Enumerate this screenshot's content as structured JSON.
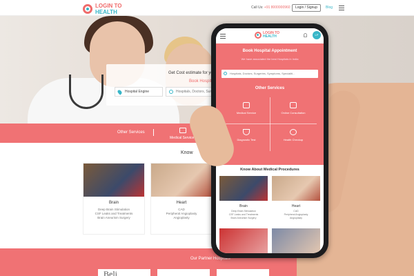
{
  "header": {
    "logo_line1": "LOGIN TO",
    "logo_line2": "HEALTH",
    "call_label": "Call Us:",
    "call_number": "+91 8000000960",
    "login_label": "Login / Signup",
    "blog_label": "Blog"
  },
  "hero": {
    "cost_title": "Get Cost estimate for yo",
    "cost_link": "Book Hospital",
    "location_value": "Hospital Engine",
    "search_placeholder": "Hospitals, Doctors, Surgeries"
  },
  "services_bar": {
    "label": "Other Services",
    "item": "Medical Service"
  },
  "know": {
    "title": "Know",
    "cards": [
      {
        "title": "Brain",
        "lines": [
          "Deep Brain Stimulation",
          "CSF Leaks and Treatments",
          "Brain Aneurism Surgery"
        ]
      },
      {
        "title": "Heart",
        "lines": [
          "CAD",
          "Peripheral Angioplasty",
          "Angioplasty"
        ]
      }
    ]
  },
  "partners": {
    "label": "Our Partner Hospitals",
    "first_logo_text": "Beli"
  },
  "phone": {
    "logo_line1": "LOGIN TO",
    "logo_line2": "HEALTH",
    "user_initials": "LP",
    "book_title": "Book Hospital Appointment",
    "book_sub": "We have associated the best Hospitals in India",
    "search_placeholder": "Hospitals, Doctors, Surgeries, Symptoms, Specialiti...",
    "other_services": "Other Services",
    "services": [
      "Medical Service",
      "Online Consultation",
      "Diagnostic Test",
      "Health Checkup"
    ],
    "know_title": "Know About Medical Procedures",
    "cards": [
      {
        "title": "Brain",
        "lines": [
          "Deep Brain Stimulation",
          "CSF Leaks and Treatments",
          "Brain Aneurism Surgery"
        ]
      },
      {
        "title": "Heart",
        "lines": [
          "CAD",
          "Peripheral Angioplasty",
          "Angioplasty"
        ]
      }
    ]
  },
  "colors": {
    "brand_pink": "#f07274",
    "brand_teal": "#38b6c8"
  }
}
